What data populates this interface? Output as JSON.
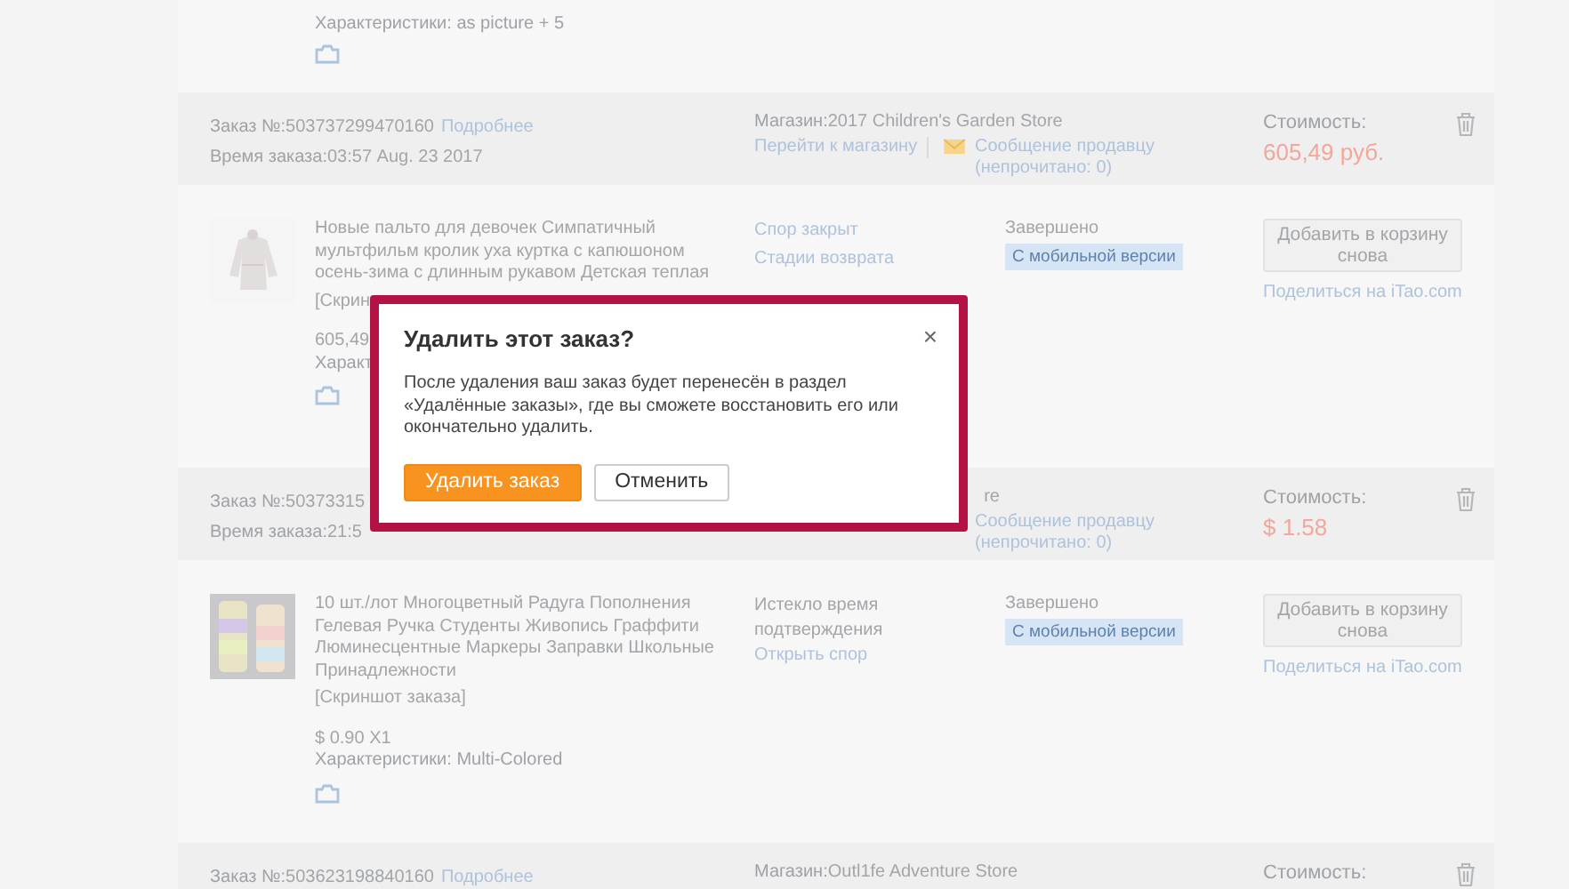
{
  "top_fragment": {
    "characteristics": "Характеристики: as picture + 5"
  },
  "orders": [
    {
      "order_label": "Заказ №:",
      "order_number": "503737299470160",
      "details_link": "Подробнее",
      "time_label": "Время заказа:",
      "time": "03:57 Aug. 23 2017",
      "store_label": "Магазин:",
      "store": "2017 Children's Garden Store",
      "store_link": "Перейти к магазину",
      "message_link": "Сообщение продавцу",
      "message_count": "(непрочитано: 0)",
      "cost_label": "Стоимость:",
      "cost": "605,49 руб.",
      "item": {
        "title": "Новые пальто для девочек Симпатичный мультфильм кролик уха куртка с капюшоном осень-зима с длинным рукавом Детская теплая",
        "screenshot": "[Скрин",
        "price": "605,49",
        "characteristics": "Характ",
        "dispute": [
          {
            "kind": "link",
            "text": "Спор закрыт"
          },
          {
            "kind": "link",
            "text": "Стадии возврата"
          }
        ],
        "status": "Завершено",
        "badge": "С мобильной версии",
        "add_button": "Добавить в корзину снова",
        "share_link": "Поделиться на iTao.com"
      }
    },
    {
      "order_label": "Заказ №:",
      "order_number": "50373315",
      "time_label": "Время заказа:",
      "time": "21:5",
      "store": "re",
      "message_link": "Сообщение продавцу",
      "message_count": "(непрочитано: 0)",
      "cost_label": "Стоимость:",
      "cost": "$ 1.58",
      "item": {
        "title": "10 шт./лот Многоцветный Радуга Пополнения Гелевая Ручка Студенты Живопись Граффити Люминесцентные Маркеры Заправки Школьные Принадлежности",
        "screenshot": "[Скриншот заказа]",
        "price": "$ 0.90 X1",
        "characteristics": "Характеристики: Multi-Colored",
        "dispute": [
          {
            "kind": "text",
            "text": "Истекло время подтверждения"
          },
          {
            "kind": "link",
            "text": "Открыть спор"
          }
        ],
        "status": "Завершено",
        "badge": "С мобильной версии",
        "add_button": "Добавить в корзину снова",
        "share_link": "Поделиться на iTao.com"
      }
    },
    {
      "order_label": "Заказ №:",
      "order_number": "503623198840160",
      "details_link": "Подробнее",
      "store_label": "Магазин:",
      "store": "Outl1fe Adventure Store",
      "cost_label": "Стоимость:"
    }
  ],
  "dialog": {
    "title": "Удалить этот заказ?",
    "close": "×",
    "body": "После удаления ваш заказ будет перенесён в раздел «Удалённые заказы», где вы сможете восстановить его или окончательно удалить.",
    "buttons": [
      {
        "kind": "primary",
        "label": "Удалить заказ"
      },
      {
        "kind": "secondary",
        "label": "Отменить"
      }
    ]
  }
}
